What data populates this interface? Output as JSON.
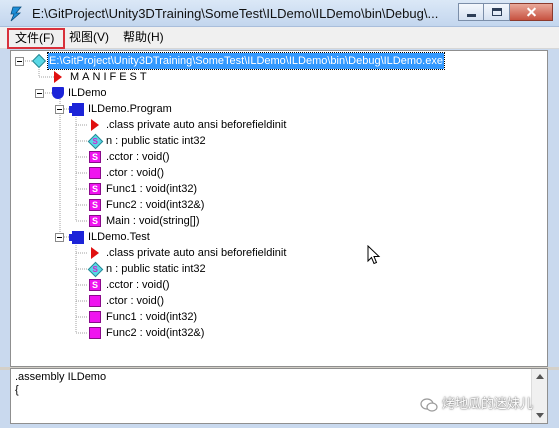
{
  "window": {
    "title": "E:\\GitProject\\Unity3DTraining\\SomeTest\\ILDemo\\ILDemo\\bin\\Debug\\...",
    "app_icon": "ildasm-lightning-icon",
    "buttons": [
      "minimize",
      "maximize",
      "close"
    ]
  },
  "menubar": {
    "file": "文件(F)",
    "view": "视图(V)",
    "help": "帮助(H)",
    "highlight_color": "#d8313b"
  },
  "tree": {
    "root": {
      "label": "E:\\GitProject\\Unity3DTraining\\SomeTest\\ILDemo\\ILDemo\\bin\\Debug\\ILDemo.exe",
      "icon": "module-diamond-icon",
      "selected": true
    },
    "manifest": {
      "label": "MANIFEST",
      "icon": "manifest-triangle-icon"
    },
    "namespace": {
      "label": "ILDemo",
      "icon": "namespace-shield-icon"
    },
    "classes": [
      {
        "label": "ILDemo.Program",
        "icon": "class-icon",
        "members": [
          {
            "label": ".class private auto ansi beforefieldinit",
            "icon": "class-info-triangle-icon"
          },
          {
            "label": "n : public static int32",
            "icon": "static-field-icon"
          },
          {
            "label": ".cctor : void()",
            "icon": "static-method-icon"
          },
          {
            "label": ".ctor : void()",
            "icon": "method-icon"
          },
          {
            "label": "Func1 : void(int32)",
            "icon": "static-method-icon"
          },
          {
            "label": "Func2 : void(int32&)",
            "icon": "static-method-icon"
          },
          {
            "label": "Main : void(string[])",
            "icon": "static-method-icon"
          }
        ]
      },
      {
        "label": "ILDemo.Test",
        "icon": "class-icon",
        "members": [
          {
            "label": ".class private auto ansi beforefieldinit",
            "icon": "class-info-triangle-icon"
          },
          {
            "label": "n : public static int32",
            "icon": "static-field-icon"
          },
          {
            "label": ".cctor : void()",
            "icon": "static-method-icon"
          },
          {
            "label": ".ctor : void()",
            "icon": "method-icon"
          },
          {
            "label": "Func1 : void(int32)",
            "icon": "method-icon"
          },
          {
            "label": "Func2 : void(int32&)",
            "icon": "method-icon"
          }
        ]
      }
    ]
  },
  "bottom_pane": {
    "lines": [
      ".assembly ILDemo",
      "{"
    ]
  },
  "watermark": {
    "text": "烤地瓜的迷妹儿",
    "icon": "wechat-icon"
  },
  "colors": {
    "selection": "#3399ff",
    "method": "#ef14ef",
    "field": "#59d8e6",
    "class": "#1c24d8",
    "manifest": "#e01010"
  }
}
